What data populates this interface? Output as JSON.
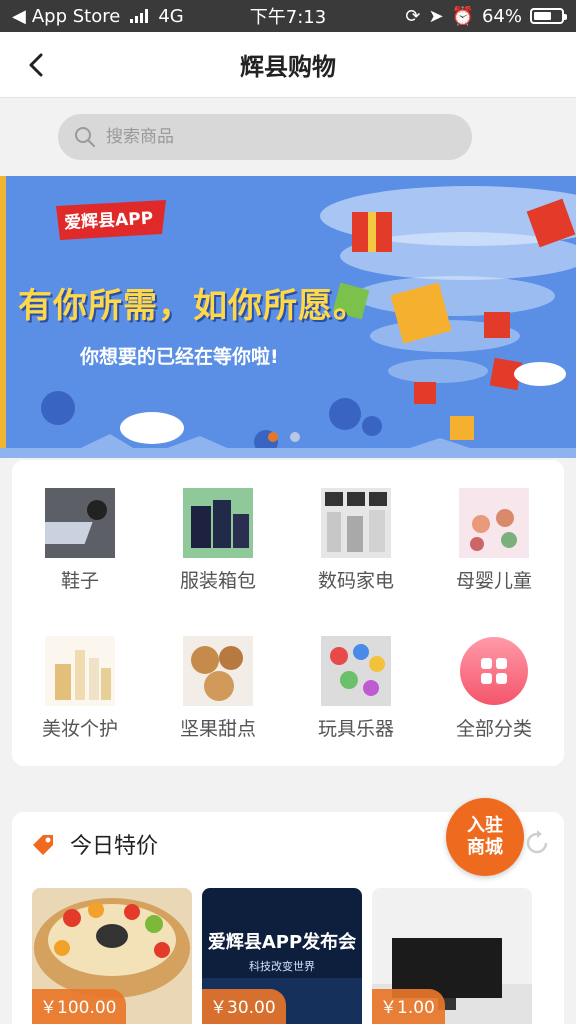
{
  "status_bar": {
    "carrier": "App Store",
    "network": "4G",
    "time": "下午7:13",
    "battery_percent": "64%",
    "battery_level": 0.64
  },
  "header": {
    "title": "辉县购物",
    "back_icon": "chevron-left-icon"
  },
  "search": {
    "placeholder": "搜索商品"
  },
  "banner": {
    "tag": "爱辉县APP",
    "headline": "有你所需，如你所愿。",
    "subline": "你想要的已经在等你啦!",
    "slide_count": 2,
    "active_slide": 1
  },
  "categories": [
    {
      "label": "鞋子",
      "icon": "laptop-photo"
    },
    {
      "label": "服装箱包",
      "icon": "luggage-photo"
    },
    {
      "label": "数码家电",
      "icon": "appliances-photo"
    },
    {
      "label": "母婴儿童",
      "icon": "kids-illustration"
    },
    {
      "label": "美妆个护",
      "icon": "cosmetics-photo"
    },
    {
      "label": "坚果甜点",
      "icon": "nuts-photo"
    },
    {
      "label": "玩具乐器",
      "icon": "toys-photo"
    },
    {
      "label": "全部分类",
      "icon": "grid-icon"
    }
  ],
  "deals": {
    "title": "今日特价",
    "products": [
      {
        "price": "￥100.00",
        "kind": "cake"
      },
      {
        "price": "￥30.00",
        "kind": "poster",
        "poster_title": "爱辉县APP发布会",
        "poster_sub": "科技改变世界"
      },
      {
        "price": "￥1.00",
        "kind": "monitor"
      }
    ]
  },
  "float_button": {
    "line1": "入驻",
    "line2": "商城"
  },
  "colors": {
    "accent": "#ee6a1e",
    "banner_bg": "#5a8fe5",
    "status_bg": "#3a3a3a"
  }
}
